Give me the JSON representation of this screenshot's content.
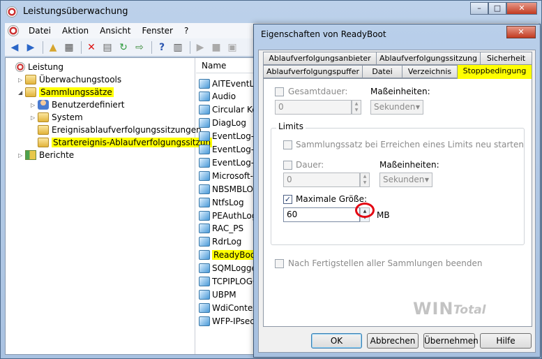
{
  "app": {
    "title": "Leistungsüberwachung",
    "minimize": "–",
    "maximize": "□",
    "close": "✕"
  },
  "menu": [
    "Datei",
    "Aktion",
    "Ansicht",
    "Fenster",
    "?"
  ],
  "tree": [
    {
      "label": "Leistung",
      "icon": "perf",
      "indent": 0,
      "tri": "",
      "hl": false
    },
    {
      "label": "Überwachungstools",
      "icon": "folder",
      "indent": 1,
      "tri": "▷",
      "hl": false
    },
    {
      "label": "Sammlungssätze",
      "icon": "folder",
      "indent": 1,
      "tri": "◢",
      "hl": true
    },
    {
      "label": "Benutzerdefiniert",
      "icon": "user",
      "indent": 2,
      "tri": "▷",
      "hl": false
    },
    {
      "label": "System",
      "icon": "folder",
      "indent": 2,
      "tri": "▷",
      "hl": false
    },
    {
      "label": "Ereignisablaufverfolgungssitzungen",
      "icon": "folder",
      "indent": 2,
      "tri": "",
      "hl": false
    },
    {
      "label": "Startereignis-Ablaufverfolgungssitzun",
      "icon": "folder",
      "indent": 2,
      "tri": "",
      "hl": true
    },
    {
      "label": "Berichte",
      "icon": "report",
      "indent": 1,
      "tri": "▷",
      "hl": false
    }
  ],
  "list": {
    "header": "Name",
    "items": [
      {
        "label": "AITEventLog",
        "hl": false
      },
      {
        "label": "Audio",
        "hl": false
      },
      {
        "label": "Circular Kernel",
        "hl": false
      },
      {
        "label": "DiagLog",
        "hl": false
      },
      {
        "label": "EventLog-Ap",
        "hl": false
      },
      {
        "label": "EventLog-Se",
        "hl": false
      },
      {
        "label": "EventLog-Sy",
        "hl": false
      },
      {
        "label": "Microsoft-W",
        "hl": false
      },
      {
        "label": "NBSMBLOG",
        "hl": false
      },
      {
        "label": "NtfsLog",
        "hl": false
      },
      {
        "label": "PEAuthLog",
        "hl": false
      },
      {
        "label": "RAC_PS",
        "hl": false
      },
      {
        "label": "RdrLog",
        "hl": false
      },
      {
        "label": "ReadyBoot",
        "hl": true
      },
      {
        "label": "SQMLogger",
        "hl": false
      },
      {
        "label": "TCPIPLOGGE",
        "hl": false
      },
      {
        "label": "UBPM",
        "hl": false
      },
      {
        "label": "WdiContext",
        "hl": false
      },
      {
        "label": "WFP-IPsec",
        "hl": false
      }
    ]
  },
  "dialog": {
    "title": "Eigenschaften von ReadyBoot",
    "close": "✕",
    "tabs_row1": [
      "Ablaufverfolgungsanbieter",
      "Ablaufverfolgungssitzung",
      "Sicherheit"
    ],
    "tabs_row2": [
      "Ablaufverfolgungspuffer",
      "Datei",
      "Verzeichnis",
      "Stoppbedingung"
    ],
    "gesamtdauer": {
      "label": "Gesamtdauer:",
      "value": "0",
      "unit_label": "Maßeinheiten:",
      "unit": "Sekunden"
    },
    "limits": {
      "title": "Limits",
      "restart": "Sammlungssatz bei Erreichen eines Limits neu starten",
      "dauer": {
        "label": "Dauer:",
        "value": "0",
        "unit_label": "Maßeinheiten:",
        "unit": "Sekunden"
      },
      "max_size": {
        "label": "Maximale Größe:",
        "value": "60",
        "unit": "MB",
        "checked": "✓"
      }
    },
    "after_all": "Nach Fertigstellen aller Sammlungen beenden",
    "buttons": {
      "ok": "OK",
      "cancel": "Abbrechen",
      "apply": "Übernehmen",
      "help": "Hilfe"
    }
  },
  "watermark": {
    "win": "WIN",
    "total": "Total"
  }
}
